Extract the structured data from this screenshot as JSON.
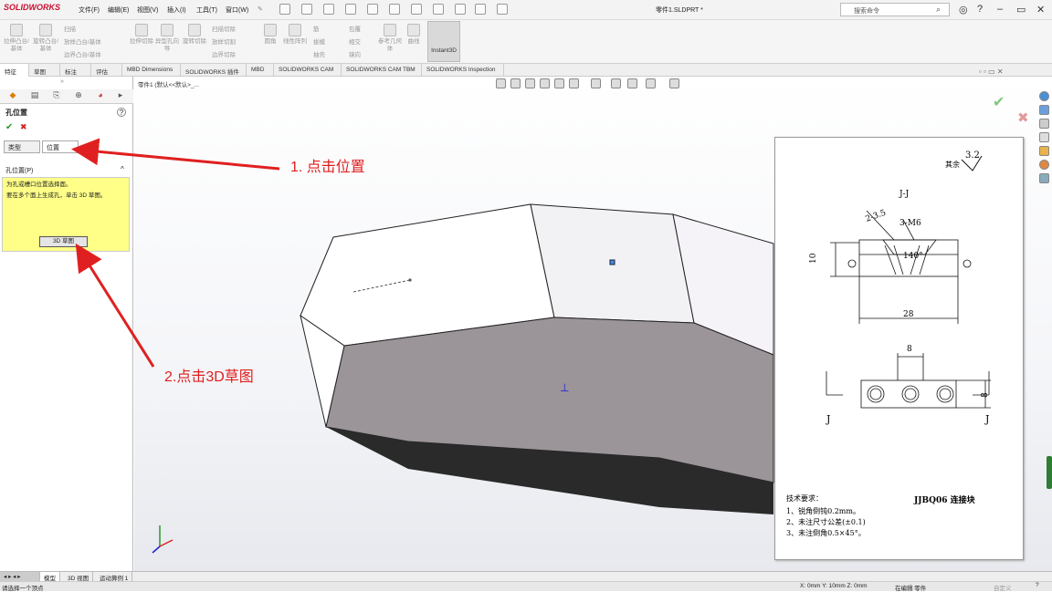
{
  "app": {
    "logo": "SOLIDWORKS",
    "doc_title": "零件1.SLDPRT *"
  },
  "menu": [
    "文件(F)",
    "编辑(E)",
    "视图(V)",
    "插入(I)",
    "工具(T)",
    "窗口(W)"
  ],
  "search": {
    "placeholder": "搜索命令"
  },
  "ribbon": {
    "buttons": [
      "拉伸凸台/基体",
      "旋转凸台/基体",
      "拉伸切除",
      "异型孔向导",
      "旋转切除",
      "圆角",
      "线性阵列",
      "筋",
      "拔模",
      "抽壳",
      "包覆",
      "相交",
      "镜向",
      "参考几何体",
      "曲线"
    ],
    "small": [
      "扫描",
      "放样凸台/基体",
      "边界凸台/基体",
      "扫描切除",
      "放样切割",
      "边界切除"
    ],
    "instant3d": "Instant3D"
  },
  "tabs": [
    "特征",
    "草图",
    "标注",
    "评估",
    "MBD Dimensions",
    "SOLIDWORKS 插件",
    "MBD",
    "SOLIDWORKS CAM",
    "SOLIDWORKS CAM TBM",
    "SOLIDWORKS Inspection"
  ],
  "panel": {
    "title": "孔位置",
    "subtabs": [
      "类型",
      "位置"
    ],
    "group": "孔位置(P)",
    "instruction1": "为孔或槽口位置选择面。",
    "instruction2": "要在多个面上生成孔，单击 3D 草图。",
    "button_3d": "3D 草图"
  },
  "viewport": {
    "tree": "零件1 (默认<<默认>_..."
  },
  "drawing": {
    "section": "J-J",
    "dims": {
      "d1": "2-3.5",
      "d2": "3-M6",
      "d3": "140°",
      "d4": "10",
      "d5": "28",
      "d6": "8",
      "d7": "8",
      "ra": "3.2",
      "ra_label": "其余"
    },
    "view_label_left": "J",
    "view_label_right": "J",
    "notes_title": "技术要求：",
    "notes": [
      "1、锐角倒钝0.2mm。",
      "2、未注尺寸公差(±0.1)",
      "3、未注倒角0.5×45°。"
    ],
    "part_name": "JJBQ06 连接块"
  },
  "annotations": {
    "step1": "1. 点击位置",
    "step2": "2.点击3D草图"
  },
  "bottom_tabs": [
    "模型",
    "3D 视图",
    "运动算例 1"
  ],
  "status": {
    "left": "请选择一个顶点",
    "coords": "X: 0mm Y: 10mm Z: 0mm",
    "mode": "在编辑 零件",
    "units": "自定义"
  },
  "colors": {
    "annotation": "#e02020",
    "part_dark": "#9b9499",
    "yellow_box": "#ffff88",
    "logo": "#c8102e"
  }
}
